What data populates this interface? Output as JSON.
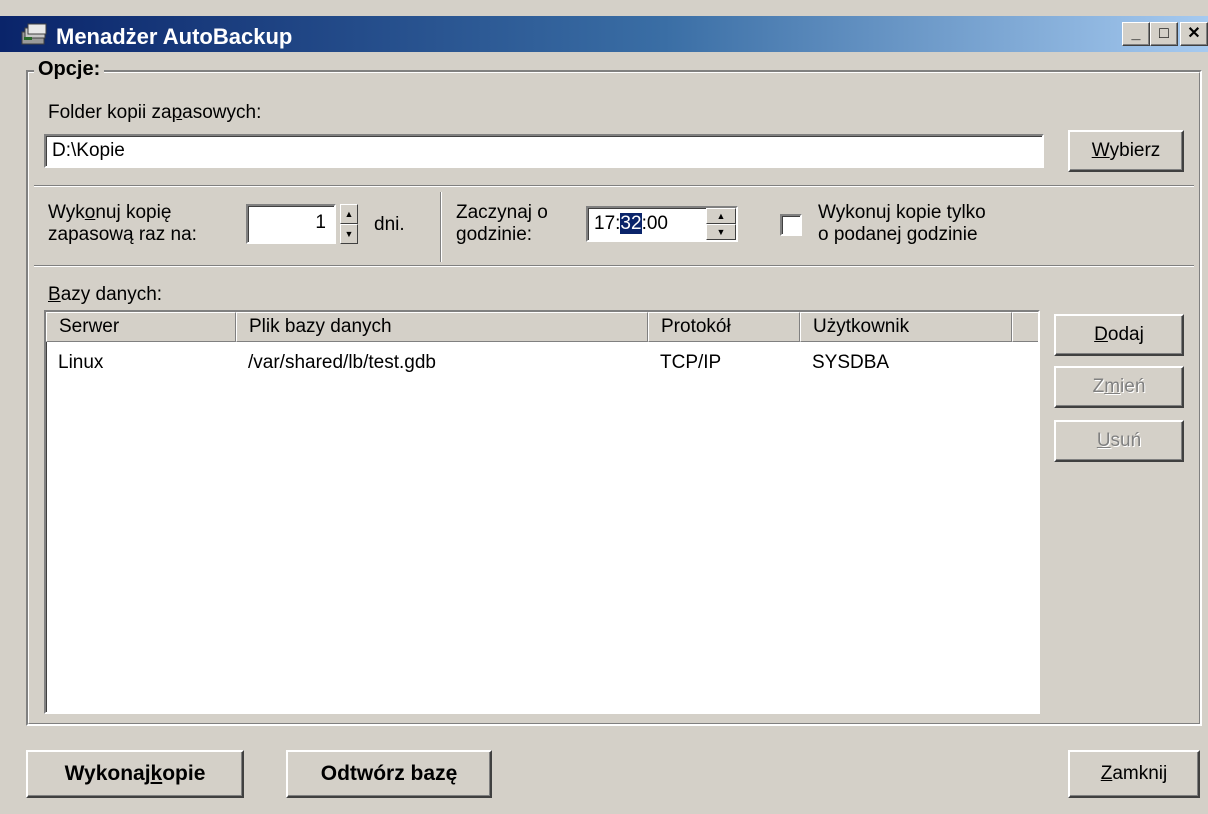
{
  "window": {
    "title": "Menadżer AutoBackup",
    "min_label": "_",
    "max_label": "□",
    "close_label": "✕"
  },
  "options": {
    "legend": "Opcje:",
    "folder_label_pre": "Folder kopii za",
    "folder_label_ul": "p",
    "folder_label_post": "asowych:",
    "folder_value": "D:\\Kopie",
    "choose_pre": "",
    "choose_ul": "W",
    "choose_post": "ybierz",
    "every_label_line1_pre": "Wyk",
    "every_label_line1_ul": "o",
    "every_label_line1_post": "nuj kopię",
    "every_label_line2": "zapasową raz na:",
    "days_value": "1",
    "days_unit": "dni.",
    "start_label_line1": "Zaczynaj o",
    "start_label_line2_ul": "g",
    "start_label_line2_post": "odzinie:",
    "time_hours": "17:",
    "time_minutes": "32",
    "time_seconds": ":00",
    "only_at_time_line1": "Wykonuj kopie tylko",
    "only_at_time_line2": "o podanej godzinie",
    "only_at_time_checked": false
  },
  "databases": {
    "label_ul": "B",
    "label_post": "azy danych:",
    "columns": [
      "Serwer",
      "Plik bazy danych",
      "Protokół",
      "Użytkownik"
    ],
    "rows": [
      {
        "server": "Linux",
        "file": "/var/shared/lb/test.gdb",
        "protocol": "TCP/IP",
        "user": "SYSDBA"
      }
    ],
    "add_ul": "D",
    "add_post": "odaj",
    "edit_pre": "Z",
    "edit_ul": "m",
    "edit_post": "ień",
    "delete_ul": "U",
    "delete_post": "suń"
  },
  "footer": {
    "backup_pre": "Wykonaj ",
    "backup_ul": "k",
    "backup_post": "opie",
    "restore_label": "Odtwórz bazę",
    "close_ul": "Z",
    "close_post": "amknij"
  },
  "colors": {
    "titlebar_start": "#0a246a",
    "titlebar_end": "#a6caf0",
    "face": "#d4d0c8",
    "selection": "#0a246a"
  }
}
